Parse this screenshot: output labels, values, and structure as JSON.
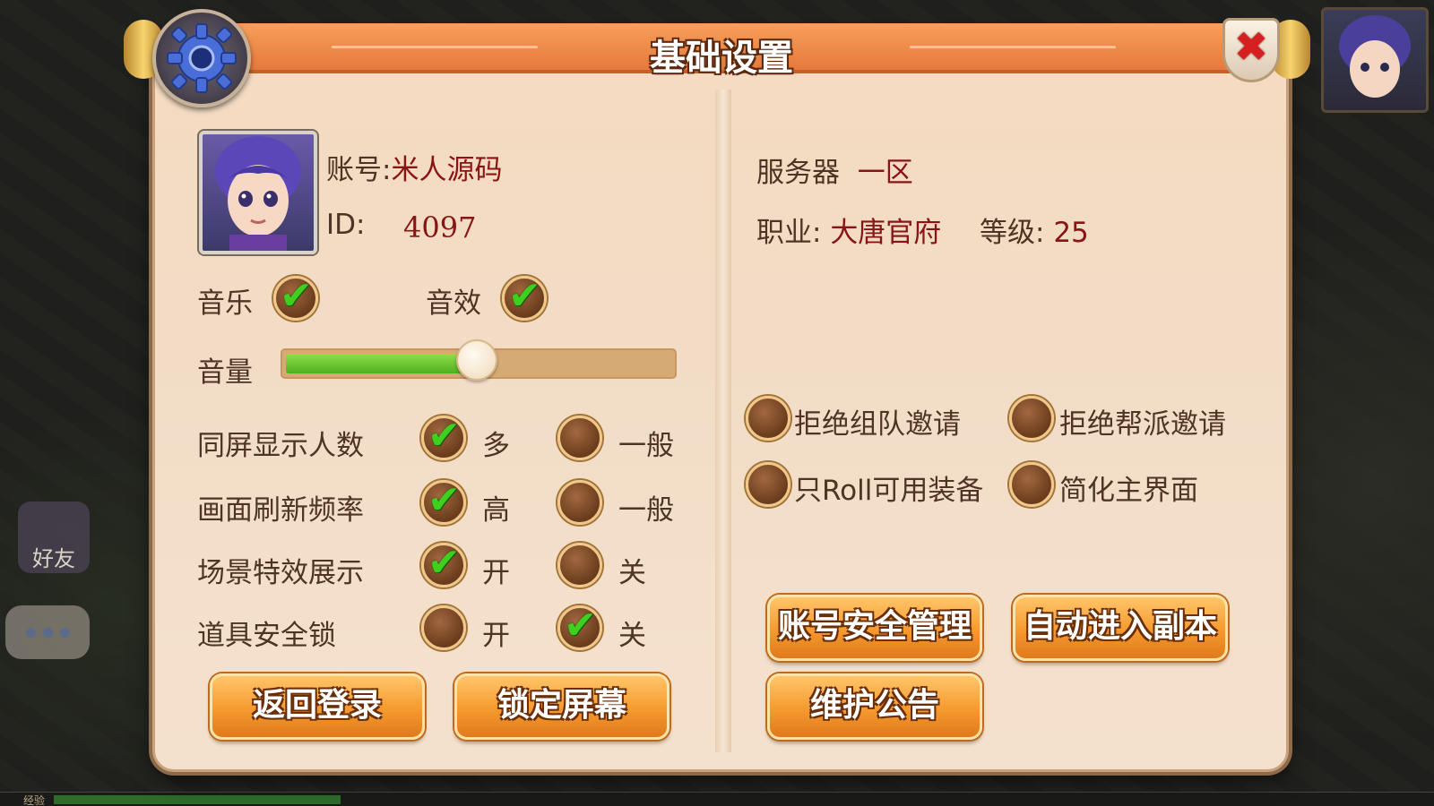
{
  "dialog": {
    "title": "基础设置",
    "close_label": "✖"
  },
  "account": {
    "account_label": "账号:",
    "account_name": "米人源码",
    "id_label": "ID:",
    "id_value": "4097",
    "server_label": "服务器",
    "server_value": "一区",
    "job_label": "职业:",
    "job_value": "大唐官府",
    "level_label": "等级:",
    "level_value": "25"
  },
  "audio": {
    "music_label": "音乐",
    "music_on": true,
    "sfx_label": "音效",
    "sfx_on": true,
    "volume_label": "音量",
    "volume_level": 0.49
  },
  "settings": [
    {
      "label": "同屏显示人数",
      "option_a": "多",
      "option_b": "一般",
      "selected": "a"
    },
    {
      "label": "画面刷新频率",
      "option_a": "高",
      "option_b": "一般",
      "selected": "a"
    },
    {
      "label": "场景特效展示",
      "option_a": "开",
      "option_b": "关",
      "selected": "a"
    },
    {
      "label": "道具安全锁",
      "option_a": "开",
      "option_b": "关",
      "selected": "b"
    }
  ],
  "toggles": [
    {
      "label": "拒绝组队邀请",
      "checked": false
    },
    {
      "label": "拒绝帮派邀请",
      "checked": false
    },
    {
      "label": "只Roll可用装备",
      "checked": false
    },
    {
      "label": "简化主界面",
      "checked": false
    }
  ],
  "buttons": {
    "back_login": "返回登录",
    "lock_screen": "锁定屏幕",
    "account_security": "账号安全管理",
    "auto_dungeon": "自动进入副本",
    "maintenance": "维护公告"
  },
  "hud": {
    "friend_label": "好友",
    "exp_label": "经验"
  },
  "colors": {
    "accent": "#f59a2e",
    "value_red": "#8a1414",
    "check_green": "#3fcf1f"
  }
}
